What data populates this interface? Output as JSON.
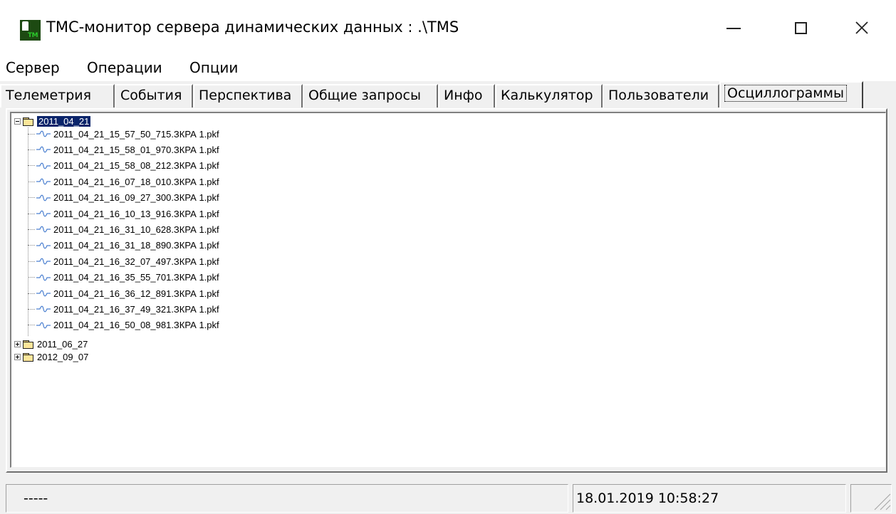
{
  "window": {
    "title": "ТМС-монитор сервера динамических данных : .\\TMS",
    "icon": "tm-app-icon",
    "icon_text": "TM"
  },
  "menu": {
    "items": [
      {
        "label": "Сервер"
      },
      {
        "label": "Операции"
      },
      {
        "label": "Опции"
      }
    ]
  },
  "tabs": [
    {
      "label": "Телеметрия"
    },
    {
      "label": "События"
    },
    {
      "label": "Перспектива"
    },
    {
      "label": "Общие запросы"
    },
    {
      "label": "Инфо"
    },
    {
      "label": "Калькулятор"
    },
    {
      "label": "Пользователи"
    },
    {
      "label": "Осциллограммы",
      "active": true
    }
  ],
  "tree": {
    "folders": [
      {
        "label": "2011_04_21",
        "expanded": true,
        "selected": true,
        "files": [
          "2011_04_21_15_57_50_715.ЗКРА 1.pkf",
          "2011_04_21_15_58_01_970.ЗКРА 1.pkf",
          "2011_04_21_15_58_08_212.ЗКРА 1.pkf",
          "2011_04_21_16_07_18_010.ЗКРА 1.pkf",
          "2011_04_21_16_09_27_300.ЗКРА 1.pkf",
          "2011_04_21_16_10_13_916.ЗКРА 1.pkf",
          "2011_04_21_16_31_10_628.ЗКРА 1.pkf",
          "2011_04_21_16_31_18_890.ЗКРА 1.pkf",
          "2011_04_21_16_32_07_497.ЗКРА 1.pkf",
          "2011_04_21_16_35_55_701.ЗКРА 1.pkf",
          "2011_04_21_16_36_12_891.ЗКРА 1.pkf",
          "2011_04_21_16_37_49_321.ЗКРА 1.pkf",
          "2011_04_21_16_50_08_981.ЗКРА 1.pkf"
        ]
      },
      {
        "label": "2011_06_27",
        "expanded": false
      },
      {
        "label": "2012_09_07",
        "expanded": false
      }
    ]
  },
  "status": {
    "left": "-----",
    "datetime": "18.01.2019 10:58:27",
    "right": ""
  },
  "colors": {
    "selection": "#0a246a",
    "wave": "#4a7fd0",
    "folder": "#fde69a"
  }
}
